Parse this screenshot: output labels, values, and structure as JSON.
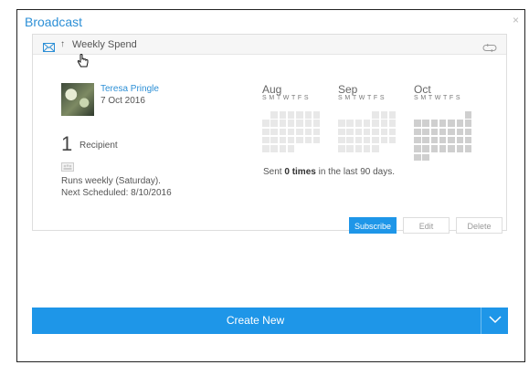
{
  "dialog": {
    "title": "Broadcast",
    "close_glyph": "×"
  },
  "card": {
    "title": "Weekly Spend",
    "icons": [
      "mail-icon",
      "arrow-up-icon",
      "pointer-cursor-icon",
      "repeat-icon",
      "group-icon"
    ],
    "user": {
      "name": "Teresa Pringle",
      "date": "7 Oct 2016"
    },
    "recipients": {
      "count": "1",
      "label": "Recipient"
    },
    "schedule": {
      "runs": "Runs weekly (Saturday).",
      "next": "Next Scheduled: 8/10/2016"
    },
    "calendar": {
      "months": [
        {
          "name": "Aug",
          "days": "S M T W T F S"
        },
        {
          "name": "Sep",
          "days": "S M T W T F S"
        },
        {
          "name": "Oct",
          "days": "S M T W T F S"
        }
      ]
    },
    "sent": {
      "prefix": "Sent ",
      "count": "0 times",
      "suffix": " in the last 90 days."
    },
    "buttons": {
      "subscribe": "Subscribe",
      "edit": "Edit",
      "delete": "Delete"
    }
  },
  "footer": {
    "create_label": "Create New"
  },
  "colors": {
    "accent": "#1e96e8",
    "link": "#2c8fd6",
    "cell_light": "#e8e8e8",
    "cell_dark": "#cfcfcf"
  }
}
